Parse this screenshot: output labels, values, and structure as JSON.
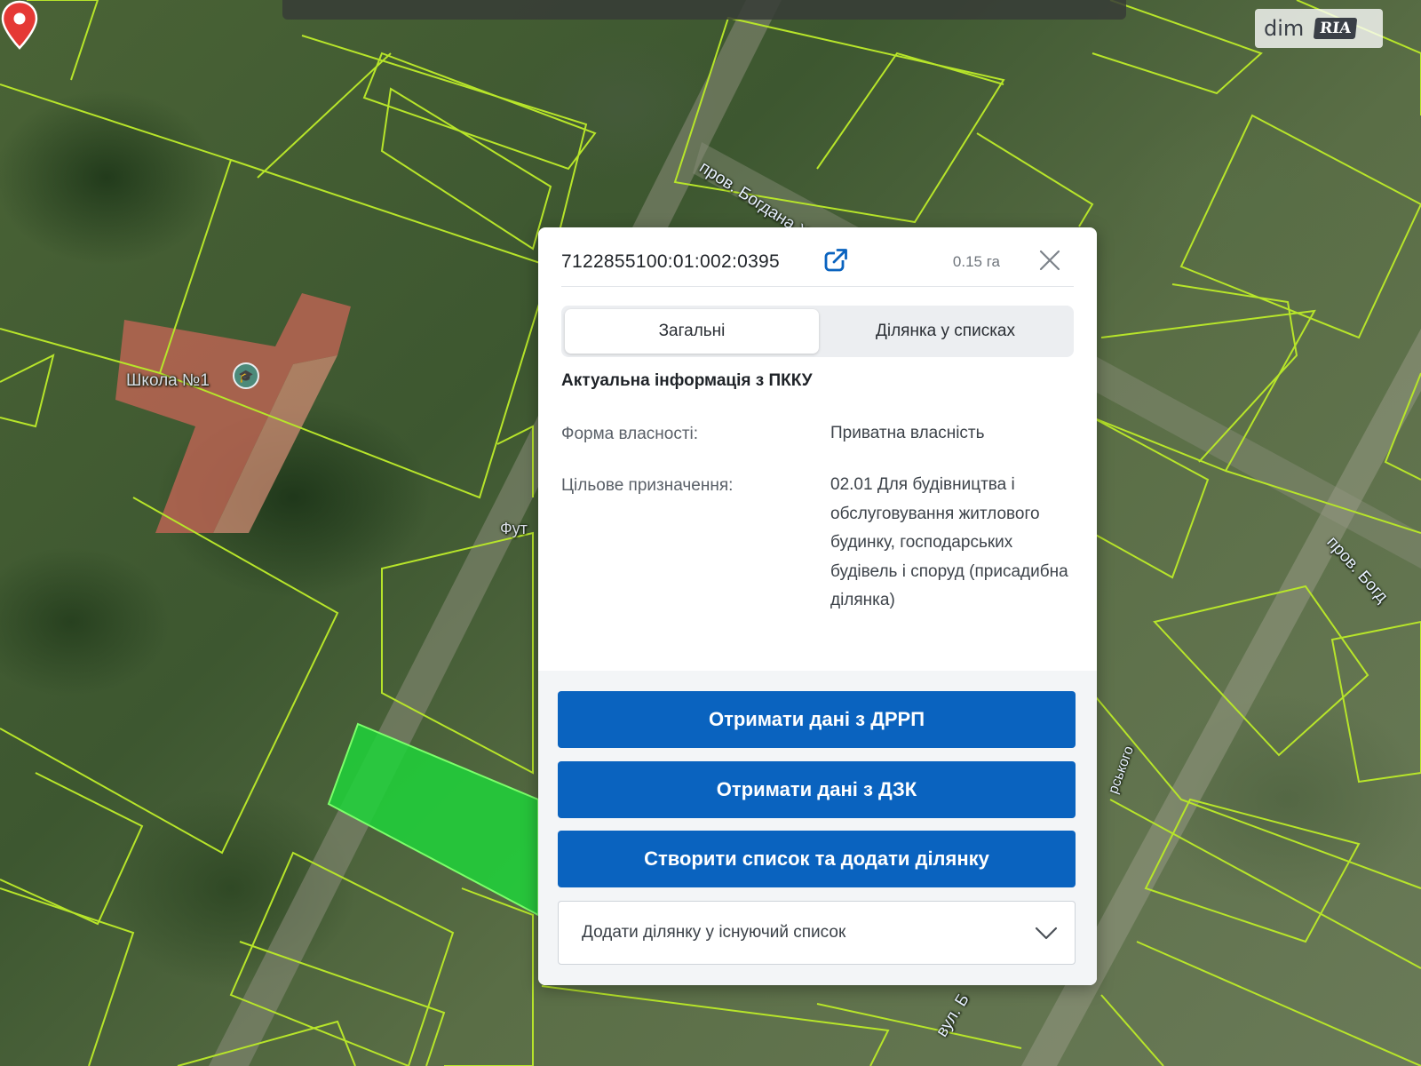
{
  "map": {
    "labels": {
      "school": "Школа №1",
      "poi_partial": "Фут",
      "street_bohdana_top": "пров. Богдана Х",
      "street_bohdana_right": "пров. Богд",
      "street_bottom": "вул. Б",
      "street_rkoho": "рського"
    },
    "icons": {
      "school_pin": "school-icon",
      "marker": "location-pin-icon"
    },
    "colors": {
      "parcel_outline": "#b7e52a",
      "selected_parcel": "#1fd33a",
      "marker": "#e53935"
    }
  },
  "branding": {
    "logo_dim": "dim",
    "logo_ria": "RIA"
  },
  "panel": {
    "cadastral_number": "7122855100:01:002:0395",
    "area": "0.15 га",
    "icons": {
      "open": "open-external-icon",
      "close": "close-icon",
      "chevron": "chevron-down-icon"
    },
    "tabs": [
      {
        "label": "Загальні",
        "active": true
      },
      {
        "label": "Ділянка у списках",
        "active": false
      }
    ],
    "section_title": "Актуальна інформація з ПККУ",
    "info": {
      "ownership_label": "Форма власності:",
      "ownership_value": "Приватна власність",
      "purpose_label": "Цільове призначення:",
      "purpose_value": "02.01 Для будівництва і обслуговування житлового будинку, господарських будівель і споруд (присадибна ділянка)"
    },
    "actions": {
      "drrp_button": "Отримати дані з ДРРП",
      "dzk_button": "Отримати дані з ДЗК",
      "create_list_button": "Створити список та додати ділянку",
      "add_to_existing": "Додати ділянку у існуючий список"
    },
    "colors": {
      "primary_button": "#0a63bf"
    }
  }
}
